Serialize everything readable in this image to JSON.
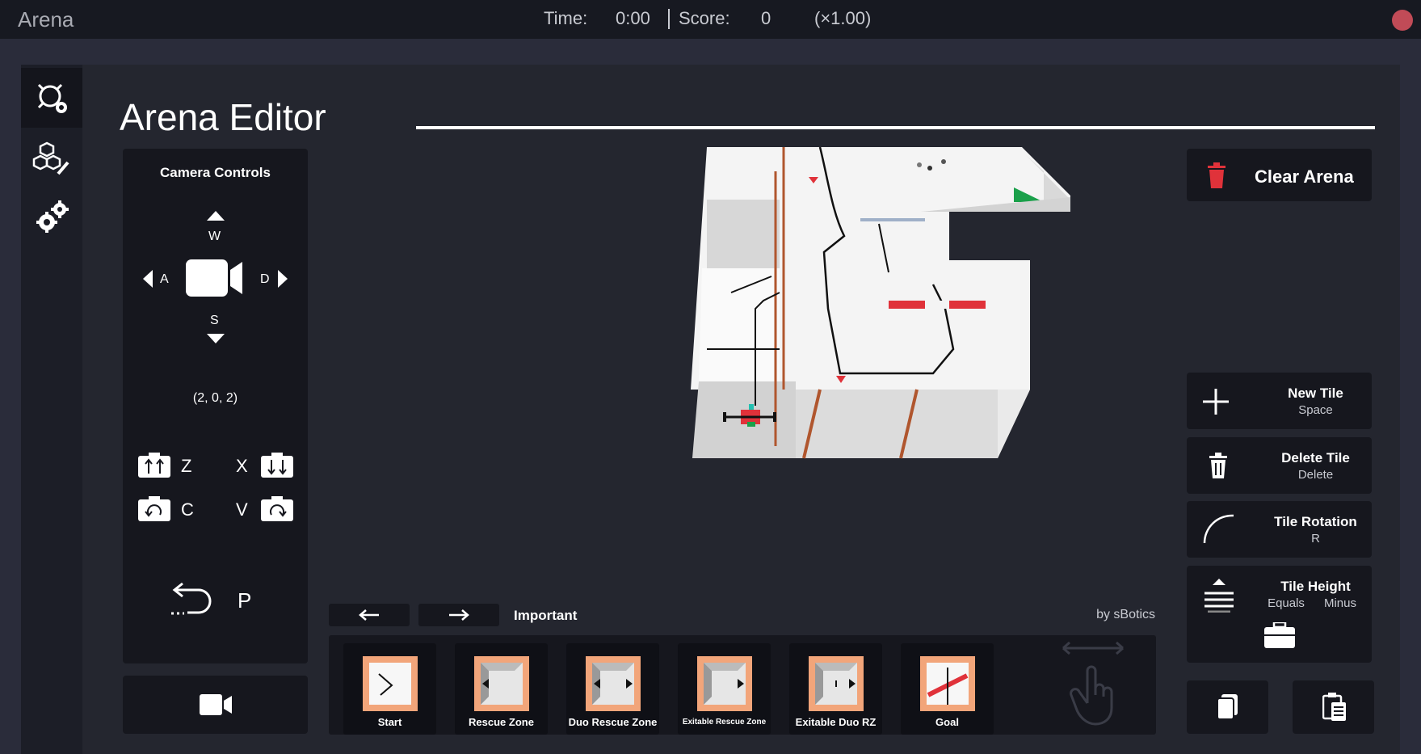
{
  "topbar": {
    "app_title": "Arena",
    "time_label": "Time:",
    "time_value": "0:00",
    "score_label": "Score:",
    "score_value": "0",
    "multiplier": "(×1.00)"
  },
  "sidebar": {
    "items": [
      {
        "name": "arena-settings",
        "icon": "robot-gear-icon"
      },
      {
        "name": "blocks-edit",
        "icon": "cubes-pencil-icon"
      },
      {
        "name": "settings",
        "icon": "gears-icon"
      }
    ]
  },
  "editor": {
    "title": "Arena Editor"
  },
  "camera": {
    "title": "Camera Controls",
    "key_w": "W",
    "key_a": "A",
    "key_s": "S",
    "key_d": "D",
    "position": "(2, 0, 2)",
    "key_z": "Z",
    "key_x": "X",
    "key_c": "C",
    "key_v": "V",
    "key_p": "P"
  },
  "tools": {
    "clear_label": "Clear Arena",
    "new_tile": {
      "label": "New Tile",
      "key": "Space"
    },
    "delete_tile": {
      "label": "Delete Tile",
      "key": "Delete"
    },
    "tile_rotation": {
      "label": "Tile Rotation",
      "key": "R"
    },
    "tile_height": {
      "label": "Tile Height",
      "key_equals": "Equals",
      "key_minus": "Minus"
    }
  },
  "palette": {
    "category": "Important",
    "credit": "by sBotics",
    "tiles": [
      {
        "label": "Start"
      },
      {
        "label": "Rescue Zone"
      },
      {
        "label": "Duo Rescue Zone"
      },
      {
        "label": "Exitable Rescue Zone"
      },
      {
        "label": "Exitable Duo RZ"
      },
      {
        "label": "Goal"
      }
    ]
  },
  "colors": {
    "background": "#2a2c3a",
    "panel": "#16171e",
    "accent_red": "#e0323a",
    "tile_orange": "#f2a57a"
  }
}
